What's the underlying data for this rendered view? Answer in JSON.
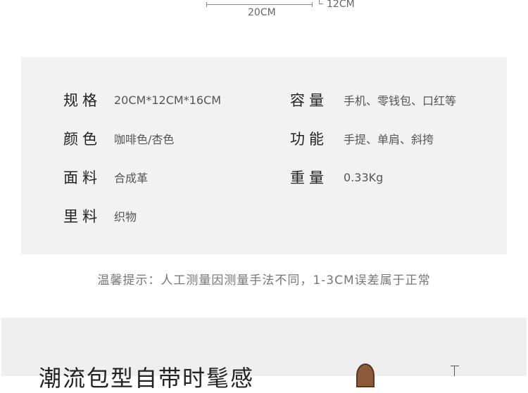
{
  "dimensions": {
    "width_label": "20CM",
    "height_label": "12CM"
  },
  "specs": {
    "left": [
      {
        "label": "规格",
        "value": "20CM*12CM*16CM"
      },
      {
        "label": "颜色",
        "value": "咖啡色/杏色"
      },
      {
        "label": "面料",
        "value": "合成革"
      },
      {
        "label": "里料",
        "value": "织物"
      }
    ],
    "right": [
      {
        "label": "容量",
        "value": "手机、零钱包、口红等"
      },
      {
        "label": "功能",
        "value": "手提、单肩、斜挎"
      },
      {
        "label": "重量",
        "value": "0.33Kg"
      }
    ]
  },
  "tip": "温馨提示：人工测量因测量手法不同，1-3CM误差属于正常",
  "section_heading": "潮流包型自带时髦感"
}
